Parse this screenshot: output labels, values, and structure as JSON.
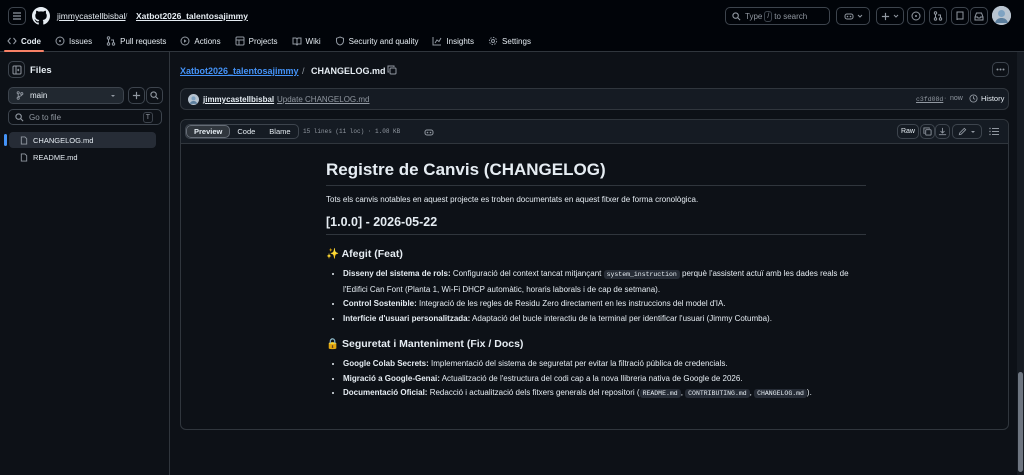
{
  "header": {
    "owner": "jimmycastellbisbal",
    "repo": "Xatbot2026_talentosajimmy",
    "search_placeholder_pre": "Type",
    "search_key": "/",
    "search_placeholder_post": "to search",
    "tabs": [
      {
        "label": "Code",
        "icon": "code-icon"
      },
      {
        "label": "Issues",
        "icon": "issue-icon"
      },
      {
        "label": "Pull requests",
        "icon": "pull-request-icon"
      },
      {
        "label": "Actions",
        "icon": "play-icon"
      },
      {
        "label": "Projects",
        "icon": "table-icon"
      },
      {
        "label": "Wiki",
        "icon": "book-icon"
      },
      {
        "label": "Security and quality",
        "icon": "shield-icon"
      },
      {
        "label": "Insights",
        "icon": "graph-icon"
      },
      {
        "label": "Settings",
        "icon": "gear-icon"
      }
    ]
  },
  "sidebar": {
    "title": "Files",
    "branch": "main",
    "goto_placeholder": "Go to file",
    "goto_key": "T",
    "files": [
      "CHANGELOG.md",
      "README.md"
    ]
  },
  "path": {
    "repo": "Xatbot2026_talentosajimmy",
    "sep": "/",
    "file": "CHANGELOG.md"
  },
  "commit": {
    "author": "jimmycastellbisbal",
    "message": "Update CHANGELOG.md",
    "sha": "c3fd08d",
    "dot": "·",
    "time": "now",
    "history": "History"
  },
  "file": {
    "views": [
      "Preview",
      "Code",
      "Blame"
    ],
    "stats": "15 lines (11 loc) · 1.08 KB",
    "raw": "Raw"
  },
  "doc": {
    "h1": "Registre de Canvis (CHANGELOG)",
    "intro": "Tots els canvis notables en aquest projecte es troben documentats en aquest fitxer de forma cronològica.",
    "h2": "[1.0.0] - 2026-05-22",
    "s1": {
      "title": "✨ Afegit (Feat)",
      "i1_b": "Disseny del sistema de rols:",
      "i1_t1": " Configuració del context tancat mitjançant ",
      "i1_code": "system_instruction",
      "i1_t2": " perquè l'assistent actuï amb les dades reals de l'Edifici Can Font (Planta 1, Wi-Fi DHCP automàtic, horaris laborals i de cap de setmana).",
      "i2_b": "Control Sostenible:",
      "i2_t": " Integració de les regles de Residu Zero directament en les instruccions del model d'IA.",
      "i3_b": "Interfície d'usuari personalitzada:",
      "i3_t": " Adaptació del bucle interactiu de la terminal per identificar l'usuari (Jimmy Cotumba)."
    },
    "s2": {
      "title": "🔒 Seguretat i Manteniment (Fix / Docs)",
      "i1_b": "Google Colab Secrets:",
      "i1_t": " Implementació del sistema de seguretat per evitar la filtració pública de credencials.",
      "i2_b": "Migració a Google-Genai:",
      "i2_t": " Actualització de l'estructura del codi cap a la nova llibreria nativa de Google de 2026.",
      "i3_b": "Documentació Oficial:",
      "i3_t": " Redacció i actualització dels fitxers generals del repositori (",
      "c1": "README.md",
      "comma1": ", ",
      "c2": "CONTRIBUTING.md",
      "comma2": ", ",
      "c3": "CHANGELOG.md",
      "end": ")."
    }
  },
  "colors": {
    "accent": "#4493f8",
    "tab_underline": "#f78166",
    "bg": "#0d1117",
    "header_bg": "#010409"
  }
}
